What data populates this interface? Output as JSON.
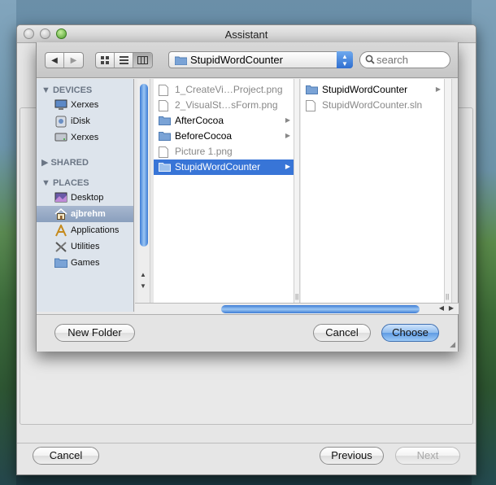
{
  "window": {
    "title": "Assistant"
  },
  "footer": {
    "cancel_label": "Cancel",
    "previous_label": "Previous",
    "next_label": "Next"
  },
  "sheet": {
    "toolbar": {
      "back_glyph": "◀",
      "forward_glyph": "▶",
      "view_icons": [
        "icon-view-icon",
        "list-view-icon",
        "column-view-icon"
      ],
      "location": "StupidWordCounter",
      "search_placeholder": "search"
    },
    "sidebar": {
      "devices_header": "DEVICES",
      "devices": [
        "Xerxes",
        "iDisk",
        "Xerxes"
      ],
      "shared_header": "SHARED",
      "places_header": "PLACES",
      "places": [
        "Desktop",
        "ajbrehm",
        "Applications",
        "Utilities",
        "Games"
      ],
      "selected_place": "ajbrehm"
    },
    "column1": [
      {
        "name": "1_CreateVi…Project.png",
        "type": "file",
        "dimmed": true
      },
      {
        "name": "2_VisualSt…sForm.png",
        "type": "file",
        "dimmed": true
      },
      {
        "name": "AfterCocoa",
        "type": "folder",
        "dimmed": false
      },
      {
        "name": "BeforeCocoa",
        "type": "folder",
        "dimmed": false
      },
      {
        "name": "Picture 1.png",
        "type": "file",
        "dimmed": true
      },
      {
        "name": "StupidWordCounter",
        "type": "folder",
        "dimmed": false,
        "selected": true
      }
    ],
    "column2": [
      {
        "name": "StupidWordCounter",
        "type": "folder",
        "dimmed": false
      },
      {
        "name": "StupidWordCounter.sln",
        "type": "file",
        "dimmed": true
      }
    ],
    "new_folder_label": "New Folder",
    "cancel_label": "Cancel",
    "choose_label": "Choose"
  },
  "colors": {
    "selection": "#3875d7",
    "default_button": "#5f9be3",
    "sidebar_bg": "#dde4ec"
  }
}
